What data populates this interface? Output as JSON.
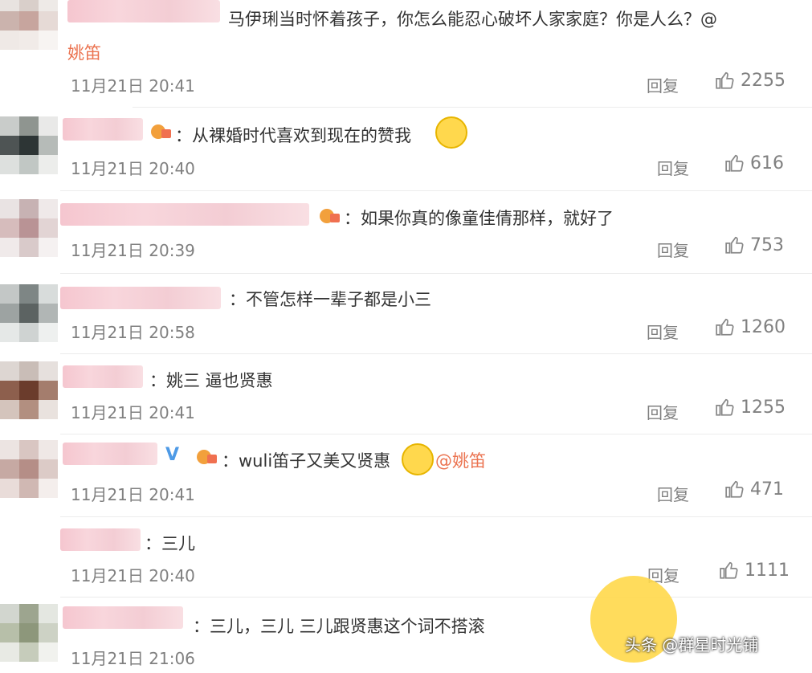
{
  "comments": [
    {
      "text": "马伊琍当时怀着孩子，你怎么能忍心破坏人家家庭？你是人么？@",
      "mention": "姚笛",
      "time": "11月21日 20:41",
      "reply": "回复",
      "likes": "2255"
    },
    {
      "text": "：从裸婚时代喜欢到现在的赞我",
      "time": "11月21日 20:40",
      "reply": "回复",
      "likes": "616"
    },
    {
      "text": "：如果你真的像童佳倩那样，就好了",
      "time": "11月21日 20:39",
      "reply": "回复",
      "likes": "753"
    },
    {
      "text": "：不管怎样一辈子都是小三",
      "time": "11月21日 20:58",
      "reply": "回复",
      "likes": "1260"
    },
    {
      "text": "：姚三  逼也贤惠",
      "time": "11月21日 20:41",
      "reply": "回复",
      "likes": "1255"
    },
    {
      "text": "：wuli笛子又美又贤惠",
      "mention": "@姚笛",
      "time": "11月21日 20:41",
      "reply": "回复",
      "likes": "471"
    },
    {
      "text": "：三儿",
      "time": "11月21日 20:40",
      "reply": "回复",
      "likes": "1111"
    },
    {
      "text": "：三儿，三儿  三儿跟贤惠这个词不搭滚",
      "time": "11月21日 21:06",
      "reply": "回复",
      "likes": ""
    }
  ],
  "watermark": "头条 @群星时光铺",
  "icons": {
    "like": "thumbs-up-icon",
    "emoji": "smiley-emoji-icon",
    "vip": "vip-badge-icon",
    "verified": "verified-v-icon"
  },
  "colors": {
    "mention": "#eb7350",
    "meta": "#808080",
    "verified": "#4e9ae6"
  }
}
